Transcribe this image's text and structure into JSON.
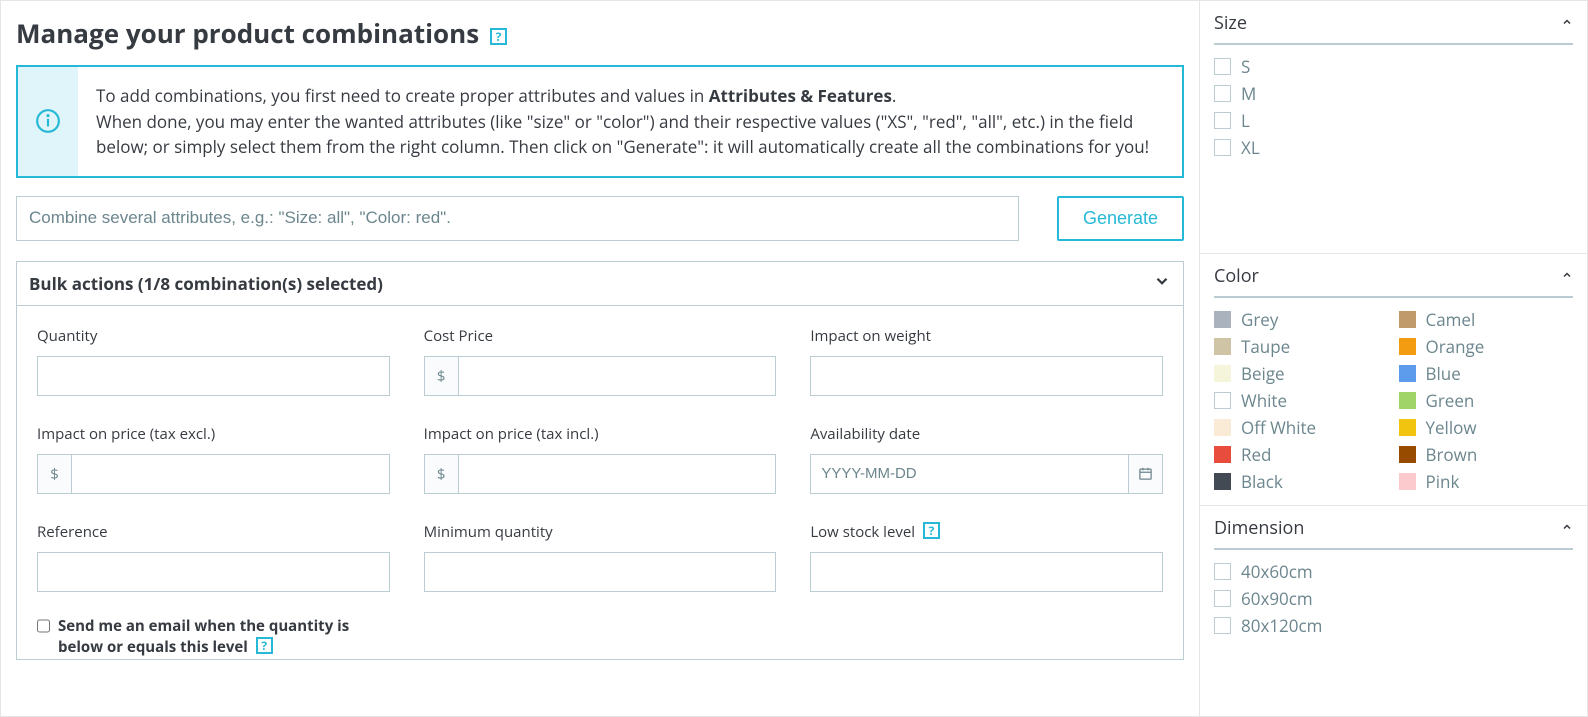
{
  "page_title": "Manage your product combinations",
  "info_message_prefix": "To add combinations, you first need to create proper attributes and values in ",
  "info_message_bold": "Attributes & Features",
  "info_message_suffix": ".",
  "info_message_rest": "When done, you may enter the wanted attributes (like \"size\" or \"color\") and their respective values (\"XS\", \"red\", \"all\", etc.) in the field below; or simply select them from the right column. Then click on \"Generate\": it will automatically create all the combinations for you!",
  "combination_placeholder": "Combine several attributes, e.g.: \"Size: all\", \"Color: red\".",
  "generate_label": "Generate",
  "bulk_header": "Bulk actions (1/8 combination(s) selected)",
  "fields": {
    "quantity": "Quantity",
    "cost_price": "Cost Price",
    "impact_weight": "Impact on weight",
    "impact_price_excl": "Impact on price (tax excl.)",
    "impact_price_incl": "Impact on price (tax incl.)",
    "availability_date": "Availability date",
    "availability_placeholder": "YYYY-MM-DD",
    "reference": "Reference",
    "min_quantity": "Minimum quantity",
    "low_stock": "Low stock level",
    "currency": "$"
  },
  "email_alert": "Send me an email when the quantity is below or equals this level",
  "sidebar": {
    "size": {
      "title": "Size",
      "options": [
        "S",
        "M",
        "L",
        "XL"
      ]
    },
    "color": {
      "title": "Color",
      "left": [
        {
          "label": "Grey",
          "hex": "#aab2bd"
        },
        {
          "label": "Taupe",
          "hex": "#cfc4a6"
        },
        {
          "label": "Beige",
          "hex": "#f5f5dc"
        },
        {
          "label": "White",
          "hex": "#ffffff",
          "border": true
        },
        {
          "label": "Off White",
          "hex": "#faebd7"
        },
        {
          "label": "Red",
          "hex": "#e84c3d"
        },
        {
          "label": "Black",
          "hex": "#434a54"
        }
      ],
      "right": [
        {
          "label": "Camel",
          "hex": "#c19a6b"
        },
        {
          "label": "Orange",
          "hex": "#f39c11"
        },
        {
          "label": "Blue",
          "hex": "#5d9cec"
        },
        {
          "label": "Green",
          "hex": "#a0d468"
        },
        {
          "label": "Yellow",
          "hex": "#f1c40f"
        },
        {
          "label": "Brown",
          "hex": "#964b00"
        },
        {
          "label": "Pink",
          "hex": "#fccacd"
        }
      ]
    },
    "dimension": {
      "title": "Dimension",
      "options": [
        "40x60cm",
        "60x90cm",
        "80x120cm"
      ]
    }
  }
}
